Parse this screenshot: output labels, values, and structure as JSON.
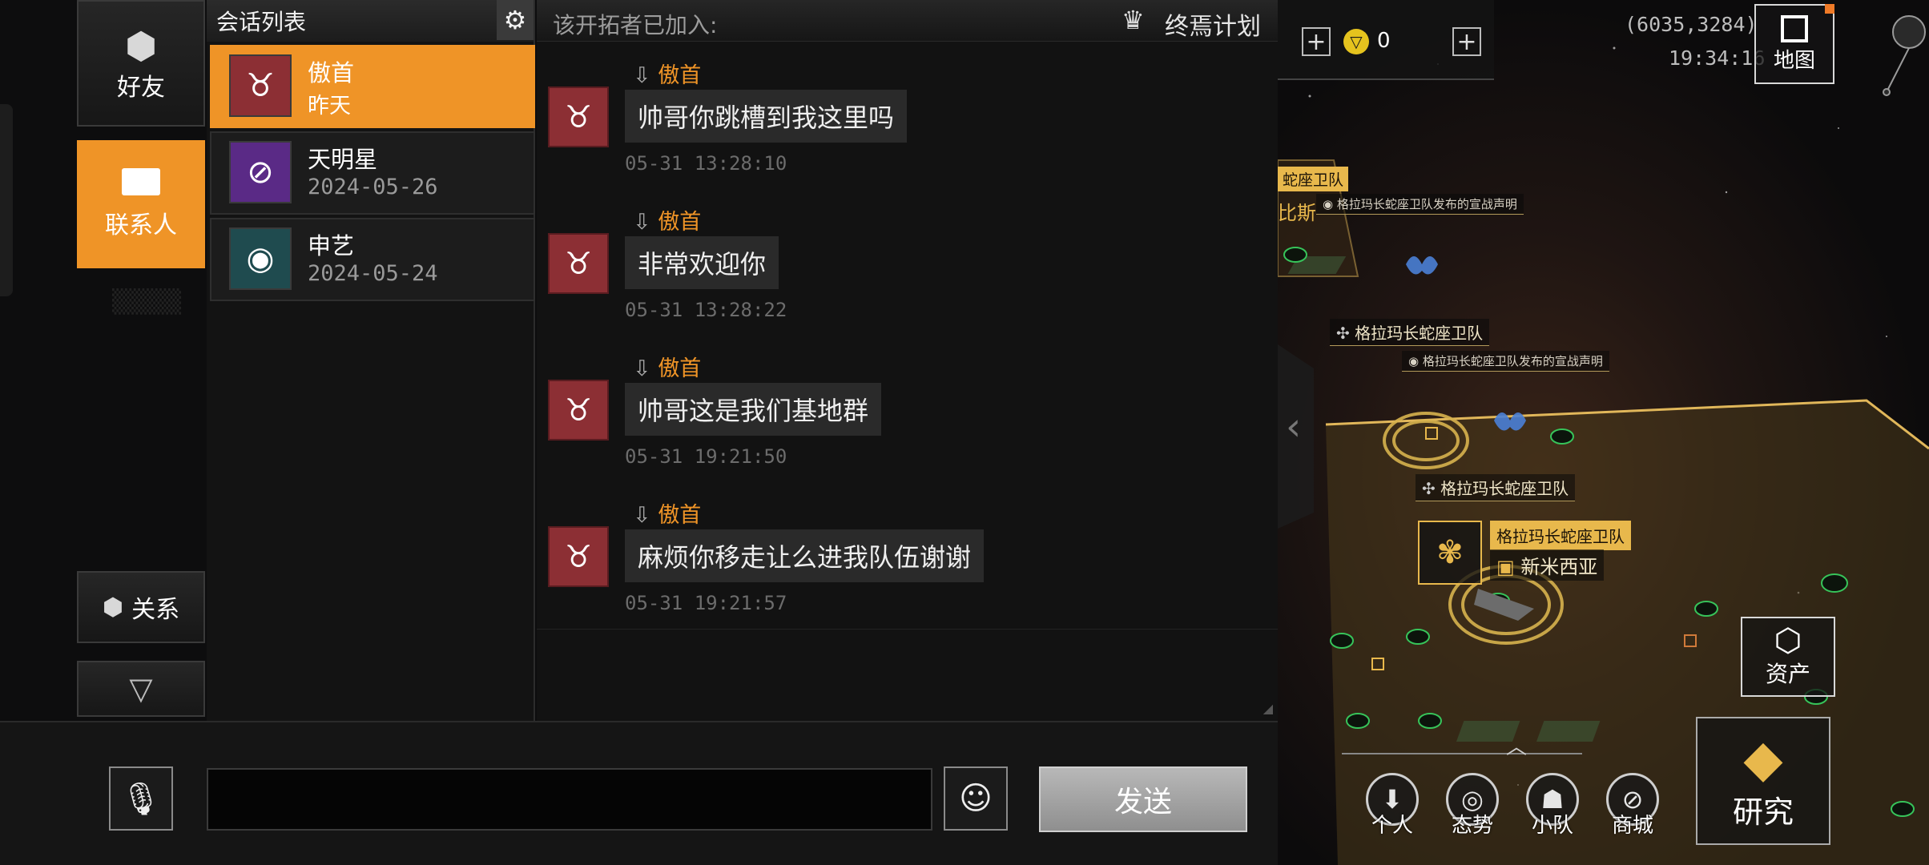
{
  "nav": {
    "friends_label": "好友",
    "contacts_label": "联系人",
    "relations_label": "关系"
  },
  "conversations": {
    "header_title": "会话列表",
    "items": [
      {
        "name": "傲首",
        "date": "昨天",
        "active": true
      },
      {
        "name": "天明星",
        "date": "2024-05-26",
        "active": false
      },
      {
        "name": "申艺",
        "date": "2024-05-24",
        "active": false
      }
    ]
  },
  "chat": {
    "header_text": "该开拓者已加入:",
    "alliance_name": "终焉计划",
    "messages": [
      {
        "sender": "傲首",
        "text": "帅哥你跳槽到我这里吗",
        "time": "05-31 13:28:10"
      },
      {
        "sender": "傲首",
        "text": "非常欢迎你",
        "time": "05-31 13:28:22"
      },
      {
        "sender": "傲首",
        "text": "帅哥这是我们基地群",
        "time": "05-31 19:21:50"
      },
      {
        "sender": "傲首",
        "text": "麻烦你移走让么进我队伍谢谢",
        "time": "05-31 19:21:57"
      }
    ]
  },
  "input": {
    "value": "",
    "send_label": "发送"
  },
  "map": {
    "resource_count": "0",
    "coordinates": "(6035,3284)",
    "clock": "19:34:16",
    "map_button_label": "地图",
    "assets_label": "资产",
    "research_label": "研究",
    "bottom_menu": [
      "个人",
      "态势",
      "小队",
      "商城"
    ],
    "labels": {
      "team_partial": "蛇座卫队",
      "city_partial": "比斯",
      "war_declaration_1": "格拉玛长蛇座卫队发布的宣战声明",
      "team_1": "格拉玛长蛇座卫队",
      "war_declaration_2": "格拉玛长蛇座卫队发布的宣战声明",
      "team_2": "格拉玛长蛇座卫队",
      "team_highlight": "格拉玛长蛇座卫队",
      "base_name": "新米西亚"
    }
  },
  "colors": {
    "accent_orange": "#ef9427",
    "avatar_red": "#8c2f34",
    "map_gold": "#e8b84c",
    "emblem_blue": "#4a7fd6"
  }
}
